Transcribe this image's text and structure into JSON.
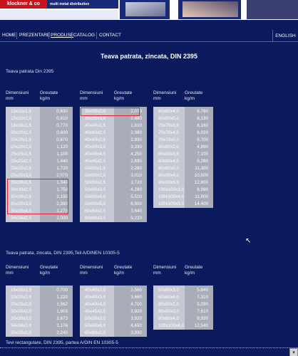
{
  "header": {
    "logo_text": "klockner & co",
    "logo_tagline": "multi metal distribution"
  },
  "nav": {
    "items": [
      "HOME",
      "PREZENTARE",
      "PRODUSE",
      "CATALOG",
      "CONTACT"
    ],
    "language": "ENGLISH"
  },
  "page_title": "Teava patrata, zincata, DIN 2395",
  "section1": {
    "title": "Teava patrata Din 2395",
    "col_dim": "Dimensiuni",
    "col_dim_unit": "mm",
    "col_wt": "Greutate",
    "col_wt_unit": "kg/m",
    "tables": [
      [
        [
          "15x15x1,5",
          "0,630"
        ],
        [
          "15x15x2,0",
          "0,810"
        ],
        [
          "18x18x1,5",
          "0,770"
        ],
        [
          "20x20x1,0",
          "0,600"
        ],
        [
          "20x20x1,5",
          "0,870"
        ],
        [
          "20x20x2,0",
          "1,120"
        ],
        [
          "25x25x1,5",
          "1,100"
        ],
        [
          "25x25x2,0",
          "1,440"
        ],
        [
          "25x25x2,5",
          "1,720"
        ],
        [
          "25x25x3,0",
          "2,070"
        ],
        [
          "30x30x1,5",
          "1,340"
        ],
        [
          "30x30x2,0",
          "1,750"
        ],
        [
          "30x30x2,5",
          "2,150"
        ],
        [
          "30x30x3,0",
          "2,390"
        ],
        [
          "30x30x4,0",
          "3,270"
        ],
        [
          "34x34x2,0",
          "2,000"
        ]
      ],
      [
        [
          "35x35x2,0",
          "2,070"
        ],
        [
          "35x35x3,0",
          "2,880"
        ],
        [
          "40x40x1,5",
          "1,810"
        ],
        [
          "40x40x2,0",
          "2,380"
        ],
        [
          "40x40x2,5",
          "2,930"
        ],
        [
          "40x40x3,0",
          "3,330"
        ],
        [
          "40x40x4,0",
          "4,250"
        ],
        [
          "45x45x2,0",
          "2,690"
        ],
        [
          "50x50x1,5",
          "2,280"
        ],
        [
          "50x50x2,0",
          "3,010"
        ],
        [
          "50x50x2,5",
          "3,720"
        ],
        [
          "50x50x3,0",
          "4,280"
        ],
        [
          "50x50x4,0",
          "5,510"
        ],
        [
          "50x50x5,0",
          "6,900"
        ],
        [
          "60x60x2,0",
          "3,640"
        ],
        [
          "60x60x3,0",
          "5,220"
        ]
      ],
      [
        [
          "60x60x4,0",
          "6,760"
        ],
        [
          "60x60x5,0",
          "8,130"
        ],
        [
          "70x70x3,0",
          "6,160"
        ],
        [
          "70x70x4,0",
          "8,020"
        ],
        [
          "70x70x5,0",
          "9,700"
        ],
        [
          "80x80x2,0",
          "4,890"
        ],
        [
          "80x80x3,0",
          "7,100"
        ],
        [
          "80x80x4,0",
          "9,280"
        ],
        [
          "80x80x5,0",
          "11,300"
        ],
        [
          "90x90x4,0",
          "10,500"
        ],
        [
          "90x90x5,0",
          "12,800"
        ],
        [
          "100x100x3,0",
          "8,990"
        ],
        [
          "100x100x4,0",
          "11,800"
        ],
        [
          "100x100x5,0",
          "14,400"
        ]
      ]
    ]
  },
  "section2": {
    "title": "Teava patrata, zincata, DIN 2395,Teil A/DINEN 10305-5",
    "col_dim": "Dimensiuni",
    "col_dim_unit": "mm",
    "col_wt": "Greutate",
    "col_wt_unit": "kg/m",
    "tables": [
      [
        [
          "15x15x1,5",
          "0,700"
        ],
        [
          "20x20x2,0",
          "1,220"
        ],
        [
          "25x25x2,0",
          "1,562"
        ],
        [
          "30x30x2,0",
          "1,903"
        ],
        [
          "30x30x3,0",
          "2,673"
        ],
        [
          "34x34x2,0",
          "2,176"
        ],
        [
          "35x35x2,0",
          "2,240"
        ]
      ],
      [
        [
          "40x40x2,0",
          "2,560"
        ],
        [
          "40x40x3,0",
          "3,660"
        ],
        [
          "40x40x4,0",
          "4,700"
        ],
        [
          "45x45x2,5",
          "2,920"
        ],
        [
          "50x50x3,0",
          "3,920"
        ],
        [
          "50x50x4,0",
          "4,650"
        ],
        [
          "60x60x2,0",
          "3,930"
        ]
      ],
      [
        [
          "60x60x3,0",
          "5,640"
        ],
        [
          "60x60x4,0",
          "7,310"
        ],
        [
          "80x80x2,0",
          "5,290"
        ],
        [
          "80x80x3,0",
          "7,610"
        ],
        [
          "80x80x4,0",
          "9,930"
        ],
        [
          "100x100x4,0",
          "12,540"
        ]
      ]
    ]
  },
  "section3": {
    "title": "Tevi rectangulare, DIN 2395, partea A/DIN EN 10305-5"
  }
}
